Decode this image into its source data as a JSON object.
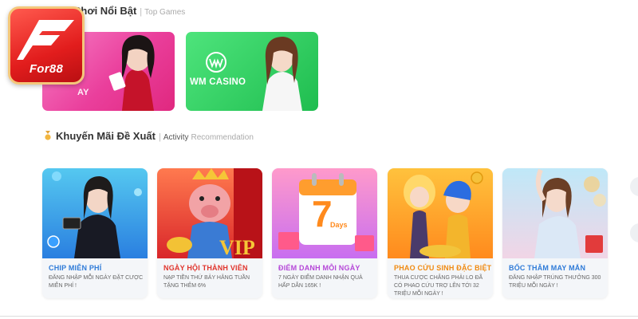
{
  "brand": {
    "name": "For88"
  },
  "top_games": {
    "title": "Chơi Nổi Bật",
    "separator": "|",
    "subtitle": "Top Games",
    "cards": [
      {
        "label": "AY"
      },
      {
        "label": "WM CASINO"
      }
    ]
  },
  "activity": {
    "title": "Khuyến Mãi Đề Xuất",
    "separator": "|",
    "subtitle": "Activity",
    "subtitle_2": "Recommendation",
    "promos": [
      {
        "title": "CHIP MIỄN PHÍ",
        "desc": "Đăng nhập mỗi ngày đặt cược miễn phí !",
        "color": "#2f7bd8"
      },
      {
        "title": "NGÀY HỘI THÀNH VIÊN",
        "desc": "Nạp tiền thứ bảy hằng tuần tặng thêm 6%",
        "color": "#e0342c"
      },
      {
        "title": "ĐIỂM DANH MỖI NGÀY",
        "desc": "7 ngày điểm danh nhận quà hấp dẫn 165K !",
        "color": "#b547d8",
        "badge_number": "7",
        "badge_text": "Days"
      },
      {
        "title": "PHAO CỨU SINH ĐẶC BIỆT",
        "desc": "Thua cược chẳng phải lo đã có phao cứu trợ lên tới 32 triệu mỗi ngày !",
        "color": "#f08a12"
      },
      {
        "title": "BỐC THĂM MAY MẮN",
        "desc": "Đăng nhập trúng thưởng 300 triệu mỗi ngày !",
        "color": "#2f7bd8"
      }
    ]
  }
}
